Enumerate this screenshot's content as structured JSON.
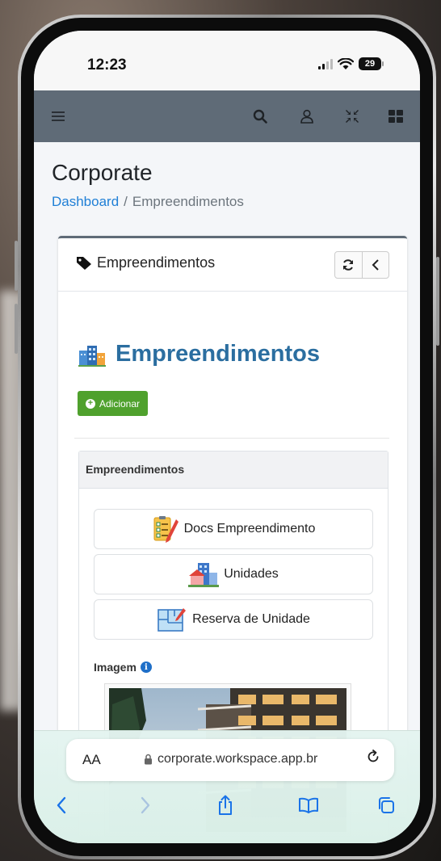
{
  "status_bar": {
    "time": "12:23",
    "battery": "29"
  },
  "navbar": {
    "icons": [
      "hamburger-menu-icon",
      "search-icon",
      "user-icon",
      "compress-icon",
      "grid-icon"
    ]
  },
  "page": {
    "title": "Corporate",
    "breadcrumb": {
      "home": "Dashboard",
      "separator": "/",
      "current": "Empreendimentos"
    }
  },
  "card": {
    "title": "Empreendimentos",
    "heading": "Empreendimentos",
    "add_label": "Adicionar",
    "panel": {
      "title": "Empreendimentos",
      "links": [
        {
          "label": "Docs Empreendimento",
          "icon": "document-checklist-icon"
        },
        {
          "label": "Unidades",
          "icon": "buildings-icon"
        },
        {
          "label": "Reserva de Unidade",
          "icon": "floorplan-icon"
        }
      ],
      "image_label": "Imagem",
      "info_glyph": "i"
    }
  },
  "browser": {
    "aa_label": "AA",
    "url": "corporate.workspace.app.br"
  },
  "colors": {
    "navbar": "#5f6b77",
    "link": "#1f7fd6",
    "heading": "#2b6ea0",
    "add_button": "#4fa12d",
    "safari_accent": "#1a73e8"
  }
}
